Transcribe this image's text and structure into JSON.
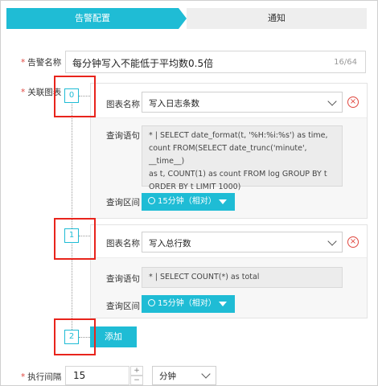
{
  "steps": {
    "active": "告警配置",
    "next": "通知"
  },
  "form": {
    "required_mark": "*",
    "alert_name_label": "告警名称",
    "alert_name_value": "每分钟写入不能低于平均数0.5倍",
    "alert_name_count": "16/64",
    "linked_charts_label": "关联图表",
    "interval_label": "执行间隔",
    "interval_value": "15",
    "interval_unit": "分钟",
    "stepper_plus": "+",
    "stepper_minus": "−"
  },
  "charts": [
    {
      "index": "0",
      "chart_name_label": "图表名称",
      "chart_name": "写入日志条数",
      "query_label": "查询语句",
      "query": "* | SELECT date_format(t, '%H:%i:%s') as time,\ncount FROM(SELECT date_trunc('minute', __time__)\nas t, COUNT(1) as count FROM log GROUP BY t\nORDER BY t LIMIT 1000)",
      "range_label": "查询区间",
      "range_value": "15分钟（相对）"
    },
    {
      "index": "1",
      "chart_name_label": "图表名称",
      "chart_name": "写入总行数",
      "query_label": "查询语句",
      "query": "* | SELECT COUNT(*) as total",
      "range_label": "查询区间",
      "range_value": "15分钟（相对）"
    }
  ],
  "add_node_index": "2",
  "add_button_label": "添加",
  "delete_icon_glyph": "×",
  "colors": {
    "accent": "#1fbcd5",
    "highlight_box": "#e8241c",
    "required": "#e0463e"
  }
}
